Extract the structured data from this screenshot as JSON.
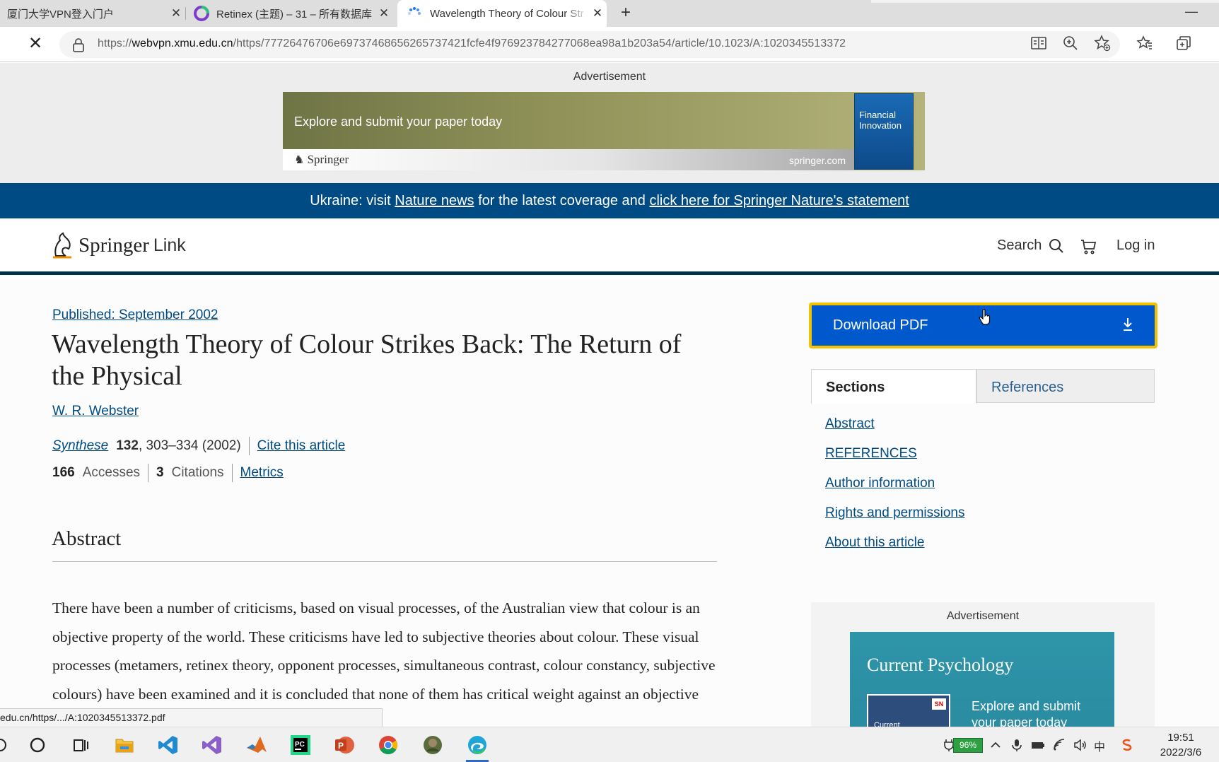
{
  "browser": {
    "tabs": [
      {
        "title": "厦门大学VPN登入门户"
      },
      {
        "title": "Retinex (主题) – 31 – 所有数据库"
      },
      {
        "title": "Wavelength Theory of Colour Str"
      }
    ],
    "url_prefix": "https://",
    "url_host": "webvpn.xmu.edu.cn",
    "url_rest": "/https/77726476706e69737468656265737421fcfe4f976923784277068ea98a1b203a54/article/10.1023/A:1020345513372",
    "new_tab_symbol": "+",
    "close_symbol": "✕",
    "stop_symbol": "✕",
    "minimize_symbol": "—"
  },
  "ad_top": {
    "label": "Advertisement",
    "text": "Explore and submit your paper today",
    "brand": "Springer",
    "brand_url": "springer.com",
    "book_title_1": "Financial",
    "book_title_2": "Innovation"
  },
  "notice": {
    "prefix": "Ukraine: visit ",
    "link1": "Nature news",
    "middle": " for the latest coverage and ",
    "link2": "click here for Springer Nature's statement"
  },
  "header": {
    "logo_springer": "Springer",
    "logo_link": "Link",
    "search_label": "Search",
    "login_label": "Log in"
  },
  "article": {
    "published": "Published: September 2002",
    "title": "Wavelength Theory of Colour Strikes Back: The Return of the Physical",
    "author": "W. R. Webster",
    "journal": "Synthese",
    "volume": "132",
    "pages": ", 303–334 (2002)",
    "cite_label": "Cite this article",
    "accesses_count": "166",
    "accesses_label": "Accesses",
    "citations_count": "3",
    "citations_label": "Citations",
    "metrics_label": "Metrics",
    "abstract_heading": "Abstract",
    "abstract_text": "There have been a number of criticisms, based on visual processes, of the Australian view that colour is an objective property of the world. These criticisms have led to subjective theories about colour. These visual processes (metamers, retinex theory, opponent processes, simultaneous contrast, colour constancy, subjective colours) have been examined and it is concluded that none of them has critical weight against an objective theory. In"
  },
  "sidebar": {
    "download_label": "Download PDF",
    "tab_sections": "Sections",
    "tab_references": "References",
    "sections": [
      {
        "label": "Abstract"
      },
      {
        "label": "REFERENCES"
      },
      {
        "label": "Author information"
      },
      {
        "label": "Rights and permissions"
      },
      {
        "label": "About this article"
      }
    ],
    "ad_label": "Advertisement",
    "ad_title": "Current Psychology",
    "ad_cta": "Explore and submit your paper today",
    "ad_book_text": "Current",
    "ad_sn": "SN"
  },
  "status_tip": "edu.cn/https/.../A:1020345513372.pdf",
  "taskbar": {
    "battery": "96%",
    "time": "19:51",
    "date": "2022/3/6",
    "ime": "中",
    "apps": [
      "cortana-icon",
      "task-view-icon",
      "file-explorer-icon",
      "vscode-icon",
      "visual-studio-icon",
      "matlab-icon",
      "pycharm-icon",
      "powerpoint-icon",
      "chrome-icon",
      "photo-app-icon",
      "edge-icon"
    ]
  },
  "colors": {
    "springer_blue": "#004b83",
    "download_blue": "#0059cc",
    "focus_yellow": "#f2c200",
    "header_rule": "#01324b"
  }
}
